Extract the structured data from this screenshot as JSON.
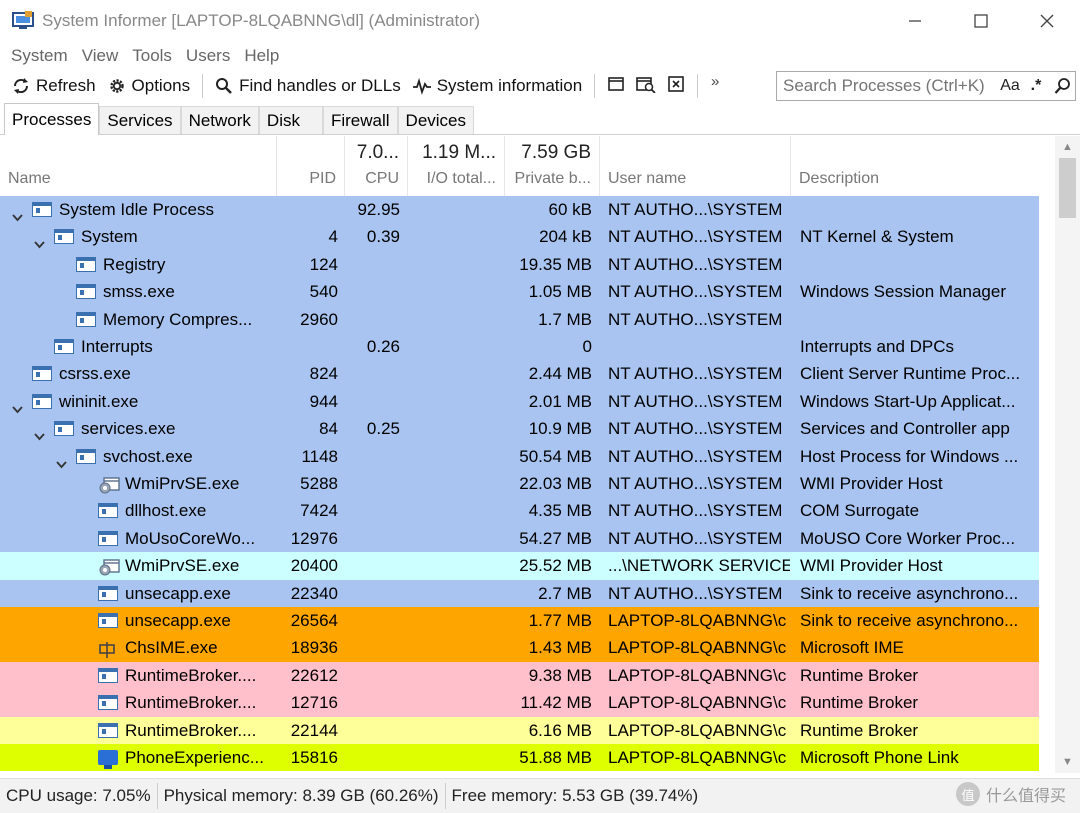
{
  "window": {
    "title": "System Informer [LAPTOP-8LQABNNG\\dl] (Administrator)",
    "controls": {
      "minimize": "—",
      "maximize": "☐",
      "close": "✕"
    }
  },
  "menu": [
    "System",
    "View",
    "Tools",
    "Users",
    "Help"
  ],
  "toolbar": {
    "refresh": "Refresh",
    "options": "Options",
    "find": "Find handles or DLLs",
    "sysinfo": "System information",
    "overflow": "»"
  },
  "search": {
    "placeholder": "Search Processes (Ctrl+K)",
    "case_label": "Aa",
    "regex_label": ".*"
  },
  "tabs": [
    "Processes",
    "Services",
    "Network",
    "Disk",
    "Firewall",
    "Devices"
  ],
  "columns": {
    "name": {
      "label": "Name"
    },
    "pid": {
      "label": "PID"
    },
    "cpu": {
      "label": "CPU",
      "stat": "7.0..."
    },
    "io": {
      "label": "I/O total...",
      "stat": "1.19 M..."
    },
    "priv": {
      "label": "Private b...",
      "stat": "7.59 GB"
    },
    "user": {
      "label": "User name"
    },
    "desc": {
      "label": "Description"
    }
  },
  "colors": {
    "system": "#a9c4f0",
    "service": "#ccffff",
    "own": "#ffa500",
    "packaged": "#ffc0cb",
    "suspended": "#ffff99",
    "immersive": "#ddff00"
  },
  "processes": [
    {
      "name": "System Idle Process",
      "pid": "",
      "cpu": "92.95",
      "priv": "60 kB",
      "user": "NT AUTHO...\\SYSTEM",
      "desc": "",
      "depth": 0,
      "expand": "down",
      "icon": "window-icon",
      "color": "system"
    },
    {
      "name": "System",
      "pid": "4",
      "cpu": "0.39",
      "priv": "204 kB",
      "user": "NT AUTHO...\\SYSTEM",
      "desc": "NT Kernel & System",
      "depth": 1,
      "expand": "down",
      "icon": "window-icon",
      "color": "system"
    },
    {
      "name": "Registry",
      "pid": "124",
      "cpu": "",
      "priv": "19.35 MB",
      "user": "NT AUTHO...\\SYSTEM",
      "desc": "",
      "depth": 2,
      "expand": "",
      "icon": "window-icon",
      "color": "system"
    },
    {
      "name": "smss.exe",
      "pid": "540",
      "cpu": "",
      "priv": "1.05 MB",
      "user": "NT AUTHO...\\SYSTEM",
      "desc": "Windows Session Manager",
      "depth": 2,
      "expand": "",
      "icon": "window-icon",
      "color": "system"
    },
    {
      "name": "Memory Compres...",
      "pid": "2960",
      "cpu": "",
      "priv": "1.7 MB",
      "user": "NT AUTHO...\\SYSTEM",
      "desc": "",
      "depth": 2,
      "expand": "",
      "icon": "window-icon",
      "color": "system"
    },
    {
      "name": "Interrupts",
      "pid": "",
      "cpu": "0.26",
      "priv": "0",
      "user": "",
      "desc": "Interrupts and DPCs",
      "depth": 1,
      "expand": "",
      "icon": "window-icon",
      "color": "system"
    },
    {
      "name": "csrss.exe",
      "pid": "824",
      "cpu": "",
      "priv": "2.44 MB",
      "user": "NT AUTHO...\\SYSTEM",
      "desc": "Client Server Runtime Proc...",
      "depth": 0,
      "expand": "",
      "icon": "window-icon",
      "color": "system"
    },
    {
      "name": "wininit.exe",
      "pid": "944",
      "cpu": "",
      "priv": "2.01 MB",
      "user": "NT AUTHO...\\SYSTEM",
      "desc": "Windows Start-Up Applicat...",
      "depth": 0,
      "expand": "down",
      "icon": "window-icon",
      "color": "system"
    },
    {
      "name": "services.exe",
      "pid": "84",
      "cpu": "0.25",
      "priv": "10.9 MB",
      "user": "NT AUTHO...\\SYSTEM",
      "desc": "Services and Controller app",
      "depth": 1,
      "expand": "down",
      "icon": "window-icon",
      "color": "system"
    },
    {
      "name": "svchost.exe",
      "pid": "1148",
      "cpu": "",
      "priv": "50.54 MB",
      "user": "NT AUTHO...\\SYSTEM",
      "desc": "Host Process for Windows ...",
      "depth": 2,
      "expand": "down",
      "icon": "window-icon",
      "color": "system"
    },
    {
      "name": "WmiPrvSE.exe",
      "pid": "5288",
      "cpu": "",
      "priv": "22.03 MB",
      "user": "NT AUTHO...\\SYSTEM",
      "desc": "WMI Provider Host",
      "depth": 3,
      "expand": "",
      "icon": "gear-window-icon",
      "color": "system"
    },
    {
      "name": "dllhost.exe",
      "pid": "7424",
      "cpu": "",
      "priv": "4.35 MB",
      "user": "NT AUTHO...\\SYSTEM",
      "desc": "COM Surrogate",
      "depth": 3,
      "expand": "",
      "icon": "window-icon",
      "color": "system"
    },
    {
      "name": "MoUsoCoreWo...",
      "pid": "12976",
      "cpu": "",
      "priv": "54.27 MB",
      "user": "NT AUTHO...\\SYSTEM",
      "desc": "MoUSO Core Worker Proc...",
      "depth": 3,
      "expand": "",
      "icon": "window-icon",
      "color": "system"
    },
    {
      "name": "WmiPrvSE.exe",
      "pid": "20400",
      "cpu": "",
      "priv": "25.52 MB",
      "user": "...\\NETWORK SERVICE",
      "desc": "WMI Provider Host",
      "depth": 3,
      "expand": "",
      "icon": "gear-window-icon",
      "color": "service"
    },
    {
      "name": "unsecapp.exe",
      "pid": "22340",
      "cpu": "",
      "priv": "2.7 MB",
      "user": "NT AUTHO...\\SYSTEM",
      "desc": "Sink to receive asynchrono...",
      "depth": 3,
      "expand": "",
      "icon": "window-icon",
      "color": "system"
    },
    {
      "name": "unsecapp.exe",
      "pid": "26564",
      "cpu": "",
      "priv": "1.77 MB",
      "user": "LAPTOP-8LQABNNG\\c",
      "desc": "Sink to receive asynchrono...",
      "depth": 3,
      "expand": "",
      "icon": "window-icon",
      "color": "own"
    },
    {
      "name": "ChsIME.exe",
      "pid": "18936",
      "cpu": "",
      "priv": "1.43 MB",
      "user": "LAPTOP-8LQABNNG\\c",
      "desc": "Microsoft IME",
      "depth": 3,
      "expand": "",
      "icon": "ime-icon",
      "color": "own"
    },
    {
      "name": "RuntimeBroker....",
      "pid": "22612",
      "cpu": "",
      "priv": "9.38 MB",
      "user": "LAPTOP-8LQABNNG\\c",
      "desc": "Runtime Broker",
      "depth": 3,
      "expand": "",
      "icon": "window-icon",
      "color": "packaged"
    },
    {
      "name": "RuntimeBroker....",
      "pid": "12716",
      "cpu": "",
      "priv": "11.42 MB",
      "user": "LAPTOP-8LQABNNG\\c",
      "desc": "Runtime Broker",
      "depth": 3,
      "expand": "",
      "icon": "window-icon",
      "color": "packaged"
    },
    {
      "name": "RuntimeBroker....",
      "pid": "22144",
      "cpu": "",
      "priv": "6.16 MB",
      "user": "LAPTOP-8LQABNNG\\c",
      "desc": "Runtime Broker",
      "depth": 3,
      "expand": "",
      "icon": "window-icon",
      "color": "suspended"
    },
    {
      "name": "PhoneExperienc...",
      "pid": "15816",
      "cpu": "",
      "priv": "51.88 MB",
      "user": "LAPTOP-8LQABNNG\\c",
      "desc": "Microsoft Phone Link",
      "depth": 3,
      "expand": "",
      "icon": "phone-icon",
      "color": "immersive"
    }
  ],
  "status": {
    "cpu": "CPU usage: 7.05%",
    "physical": "Physical memory: 8.39 GB (60.26%)",
    "free": "Free memory: 5.53 GB (39.74%)"
  },
  "watermark": {
    "text": "什么值得买",
    "icon_text": "值"
  }
}
